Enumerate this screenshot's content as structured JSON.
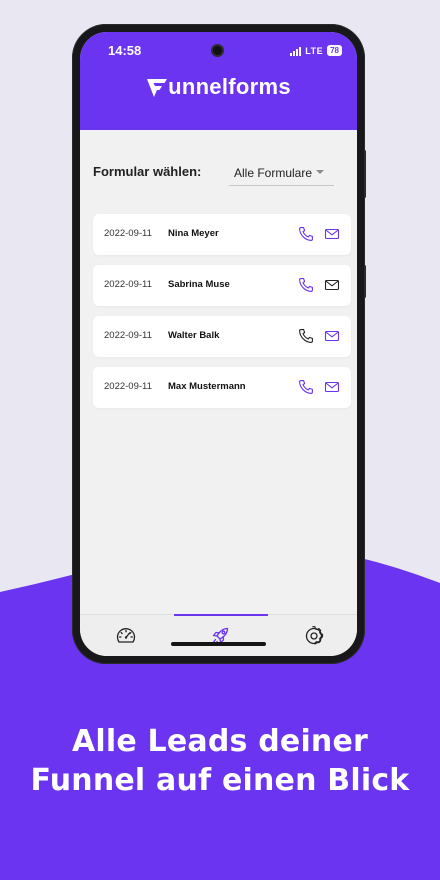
{
  "status_bar": {
    "time": "14:58",
    "network": "LTE",
    "battery": "78"
  },
  "app": {
    "brand": "Funnelforms",
    "brand_rest": "unnelforms",
    "accent_color": "#6a34f1"
  },
  "filter": {
    "label": "Formular wählen:",
    "selected": "Alle Formulare"
  },
  "leads": [
    {
      "date": "2022-09-11",
      "name": "Nina Meyer",
      "phone_icon": "phone-icon",
      "mail_icon": "mail-icon",
      "phone_color": "#6a34f1",
      "mail_color": "#6a34f1"
    },
    {
      "date": "2022-09-11",
      "name": "Sabrina Muse",
      "phone_icon": "phone-icon",
      "mail_icon": "mail-icon",
      "phone_color": "#6a34f1",
      "mail_color": "#222222"
    },
    {
      "date": "2022-09-11",
      "name": "Walter Balk",
      "phone_icon": "phone-icon",
      "mail_icon": "mail-icon",
      "phone_color": "#222222",
      "mail_color": "#6a34f1"
    },
    {
      "date": "2022-09-11",
      "name": "Max Mustermann",
      "phone_icon": "phone-icon",
      "mail_icon": "mail-icon",
      "phone_color": "#6a34f1",
      "mail_color": "#6a34f1"
    }
  ],
  "tabbar": {
    "tabs": [
      {
        "icon": "speedometer-icon",
        "active": false
      },
      {
        "icon": "rocket-icon",
        "active": true
      },
      {
        "icon": "gear-icon",
        "active": false
      }
    ]
  },
  "tagline": {
    "line1": "Alle Leads deiner",
    "line2": "Funnel auf einen Blick"
  },
  "colors": {
    "background": "#e9e8f2",
    "purple": "#6a34f1"
  }
}
